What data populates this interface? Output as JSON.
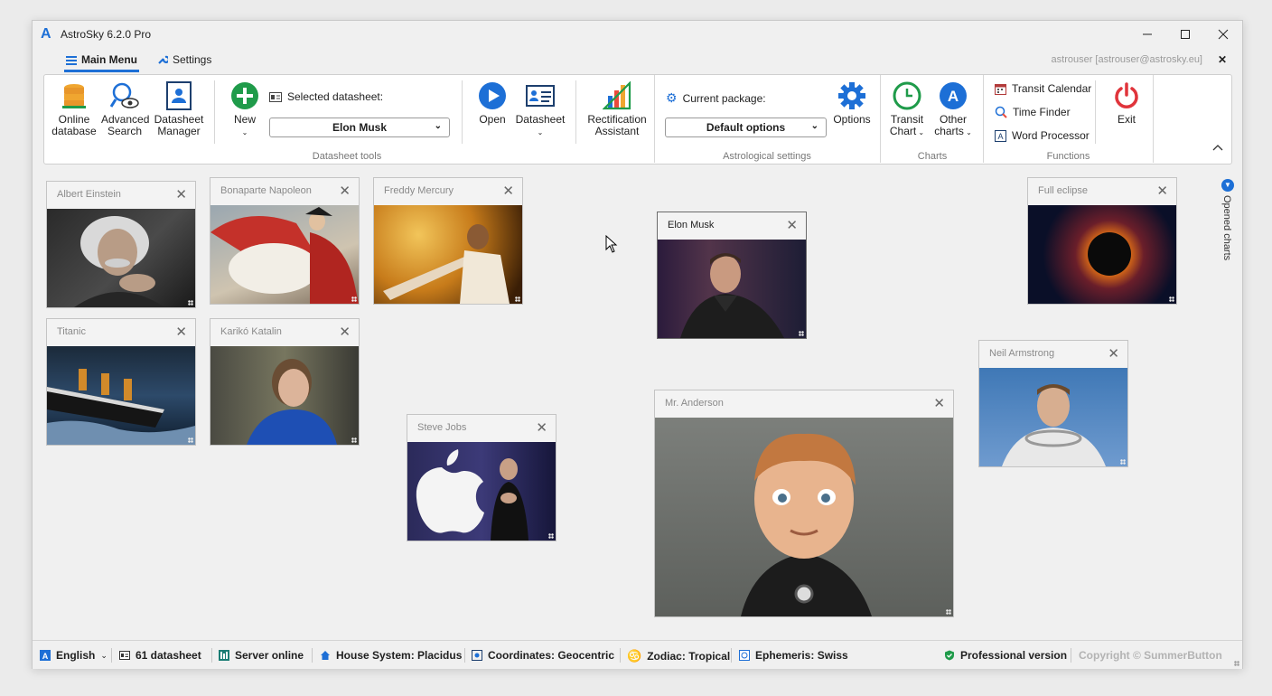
{
  "window": {
    "title": "AstroSky 6.2.0 Pro",
    "logo": "A"
  },
  "menubar": {
    "main_menu": "Main Menu",
    "settings": "Settings",
    "user": "astrouser [astrouser@astrosky.eu]"
  },
  "ribbon": {
    "online_database": [
      "Online",
      "database"
    ],
    "advanced_search": [
      "Advanced",
      "Search"
    ],
    "datasheet_manager": [
      "Datasheet",
      "Manager"
    ],
    "new": "New",
    "selected_datasheet_label": "Selected datasheet:",
    "selected_datasheet_value": "Elon Musk",
    "open": "Open",
    "datasheet": "Datasheet",
    "rectification": [
      "Rectification",
      "Assistant"
    ],
    "group_datasheet_tools": "Datasheet tools",
    "current_package_label": "Current package:",
    "current_package_value": "Default options",
    "options": "Options",
    "group_astrological_settings": "Astrological settings",
    "transit_chart": [
      "Transit",
      "Chart"
    ],
    "other_charts": [
      "Other",
      "charts"
    ],
    "group_charts": "Charts",
    "transit_calendar": "Transit Calendar",
    "time_finder": "Time Finder",
    "word_processor": "Word Processor",
    "exit": "Exit",
    "group_functions": "Functions"
  },
  "charts": [
    {
      "name": "Albert Einstein",
      "icon": "portrait-albert-einstein"
    },
    {
      "name": "Bonaparte Napoleon",
      "icon": "painting-napoleon-on-horse"
    },
    {
      "name": "Freddy Mercury",
      "icon": "portrait-freddy-mercury"
    },
    {
      "name": "Elon Musk",
      "icon": "portrait-elon-musk",
      "active": true
    },
    {
      "name": "Full eclipse",
      "icon": "solar-eclipse-image"
    },
    {
      "name": "Titanic",
      "icon": "ship-titanic-image"
    },
    {
      "name": "Karikó Katalin",
      "icon": "portrait-kariko-katalin"
    },
    {
      "name": "Neil Armstrong",
      "icon": "portrait-neil-armstrong"
    },
    {
      "name": "Steve Jobs",
      "icon": "portrait-steve-jobs"
    },
    {
      "name": "Mr. Anderson",
      "icon": "cartoon-portrait-mr-anderson"
    }
  ],
  "side_tab": {
    "label": "Opened charts"
  },
  "status": {
    "language": "English",
    "datasheet_count": "61 datasheet",
    "server": "Server online",
    "house_system": "House System: Placidus",
    "coordinates": "Coordinates: Geocentric",
    "zodiac": "Zodiac: Tropical",
    "ephemeris": "Ephemeris: Swiss",
    "version": "Professional version",
    "copyright": "Copyright © SummerButton"
  },
  "colors": {
    "accent": "#1d6fd6",
    "green": "#1f9b4a",
    "exit_red": "#e0343b"
  }
}
